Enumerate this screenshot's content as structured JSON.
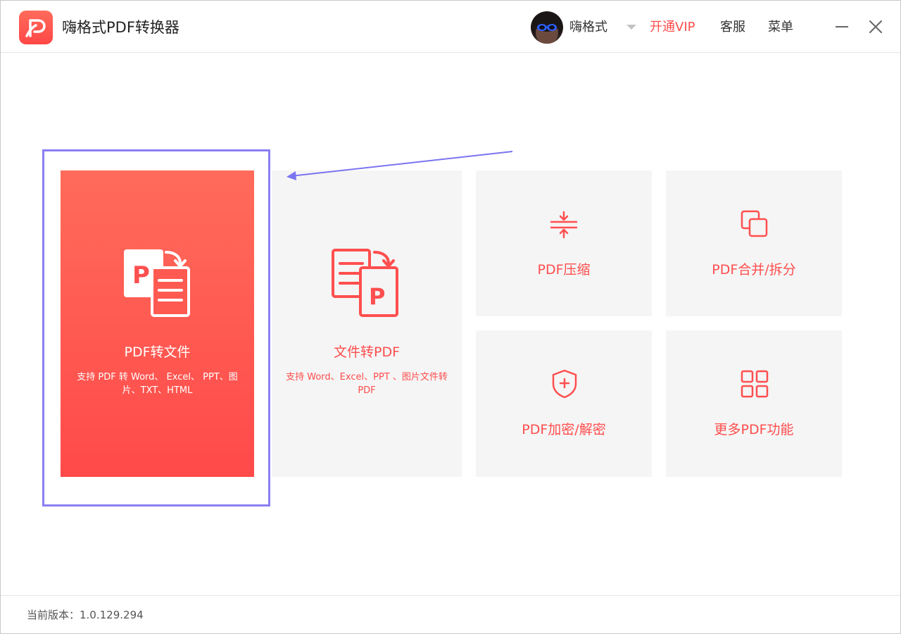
{
  "app": {
    "title": "嗨格式PDF转换器"
  },
  "header": {
    "username": "嗨格式",
    "vip_label": "开通VIP",
    "service_label": "客服",
    "menu_label": "菜单"
  },
  "tiles": {
    "pdf_to_file": {
      "title": "PDF转文件",
      "desc": "支持 PDF 转 Word、 Excel、 PPT、图片、TXT、HTML"
    },
    "file_to_pdf": {
      "title": "文件转PDF",
      "desc": "支持 Word、Excel、PPT 、图片文件转 PDF"
    },
    "compress": {
      "title": "PDF压缩"
    },
    "merge_split": {
      "title": "PDF合并/拆分"
    },
    "encrypt": {
      "title": "PDF加密/解密"
    },
    "more": {
      "title": "更多PDF功能"
    }
  },
  "footer": {
    "version": "当前版本：1.0.129.294"
  },
  "colors": {
    "accent": "#ff4d4d",
    "highlight": "#8a7ff2",
    "tile_bg": "#f5f5f5"
  }
}
